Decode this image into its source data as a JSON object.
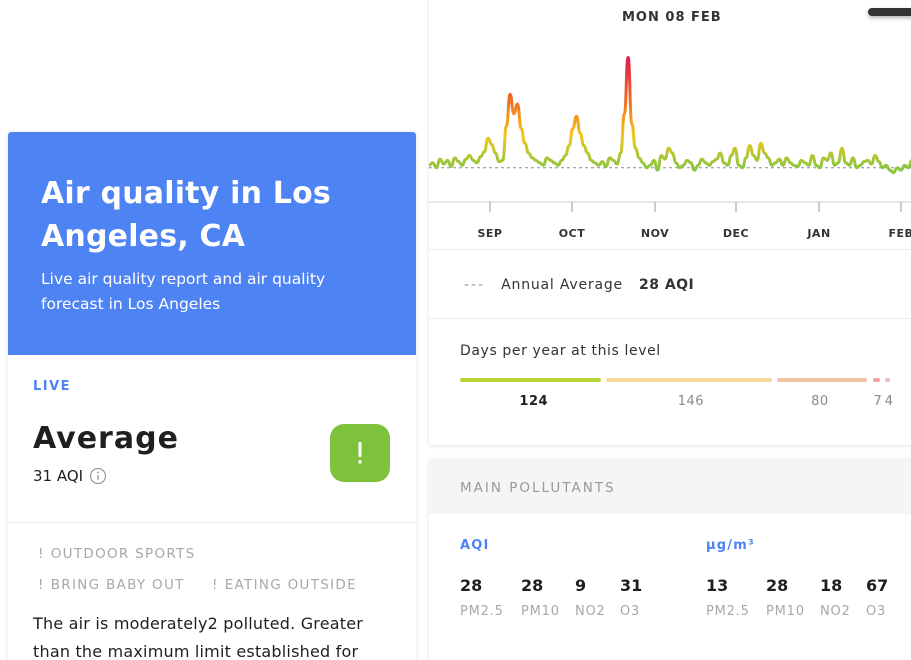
{
  "hero": {
    "title": "Air quality in Los Angeles, CA",
    "subtitle": "Live air quality report and air quality forecast in Los Angeles"
  },
  "status": {
    "live_label": "LIVE",
    "level": "Average",
    "aqi": "31 AQI",
    "info_icon": "info-icon",
    "badge_icon": "exclamation-icon",
    "badge_color": "#7ec23c"
  },
  "recommendations": [
    {
      "bang": "!",
      "text": "OUTDOOR SPORTS"
    },
    {
      "bang": "!",
      "text": "BRING BABY OUT"
    },
    {
      "bang": "!",
      "text": "EATING OUTSIDE"
    }
  ],
  "description": "The air is moderately2 polluted. Greater than the maximum limit established for",
  "chart": {
    "date": "MON 08 FEB",
    "months": [
      "SEP",
      "OCT",
      "NOV",
      "DEC",
      "JAN",
      "FEB"
    ],
    "annual_average_aqi": 28
  },
  "chart_data": {
    "type": "line",
    "title": "",
    "xlabel": "",
    "ylabel": "",
    "categories": [
      "SEP",
      "OCT",
      "NOV",
      "DEC",
      "JAN",
      "FEB"
    ],
    "series": [
      {
        "values": [
          30,
          32,
          28,
          35,
          31,
          34,
          29,
          36,
          33,
          30,
          35,
          38,
          34,
          32,
          37,
          41,
          52,
          47,
          40,
          33,
          34,
          62,
          88,
          72,
          80,
          60,
          48,
          40,
          36,
          34,
          32,
          30,
          36,
          34,
          32,
          30,
          34,
          38,
          46,
          60,
          70,
          56,
          46,
          40,
          34,
          32,
          30,
          33,
          29,
          36,
          34,
          31,
          40,
          72,
          118,
          64,
          44,
          36,
          32,
          28,
          30,
          34,
          26,
          38,
          35,
          44,
          40,
          32,
          28,
          30,
          34,
          32,
          26,
          30,
          35,
          32,
          30,
          33,
          35,
          40,
          32,
          30,
          38,
          44,
          30,
          28,
          36,
          46,
          38,
          34,
          48,
          40,
          36,
          30,
          32,
          35,
          30,
          36,
          32,
          30,
          29,
          34,
          32,
          30,
          38,
          30,
          28,
          36,
          34,
          40,
          30,
          32,
          44,
          32,
          30,
          36,
          28,
          30,
          33,
          34,
          31,
          38,
          33,
          28,
          30,
          26,
          24,
          28,
          26,
          30,
          28,
          34
        ]
      }
    ],
    "reference_line": {
      "label": "Annual Average",
      "value": 28
    },
    "color_scale": [
      "#8cc63f",
      "#f5c518",
      "#ef7d21",
      "#e01a4f"
    ],
    "grid": false
  },
  "average": {
    "dash": "---",
    "label": "Annual Average",
    "value": "28 AQI"
  },
  "days": {
    "title": "Days per year at this level",
    "levels": [
      {
        "count": "124",
        "days": 124,
        "color": "#b7d433",
        "bold": true
      },
      {
        "count": "146",
        "days": 146,
        "color": "#f6d79a",
        "bold": false
      },
      {
        "count": "80",
        "days": 80,
        "color": "#f2c2a5",
        "bold": false
      },
      {
        "count": "7",
        "days": 7,
        "color": "#f3a0a8",
        "bold": false
      },
      {
        "count": "4",
        "days": 4,
        "color": "#e8b7c9",
        "bold": false
      }
    ]
  },
  "pollutants": {
    "title": "MAIN POLLUTANTS",
    "aqi_label": "AQI",
    "conc_label": "μg/m³",
    "aqi": [
      {
        "value": "28",
        "name": "PM2.5"
      },
      {
        "value": "28",
        "name": "PM10"
      },
      {
        "value": "9",
        "name": "NO2"
      },
      {
        "value": "31",
        "name": "O3"
      }
    ],
    "concentration": [
      {
        "value": "13",
        "name": "PM2.5"
      },
      {
        "value": "28",
        "name": "PM10"
      },
      {
        "value": "18",
        "name": "NO2"
      },
      {
        "value": "67",
        "name": "O3"
      }
    ]
  }
}
